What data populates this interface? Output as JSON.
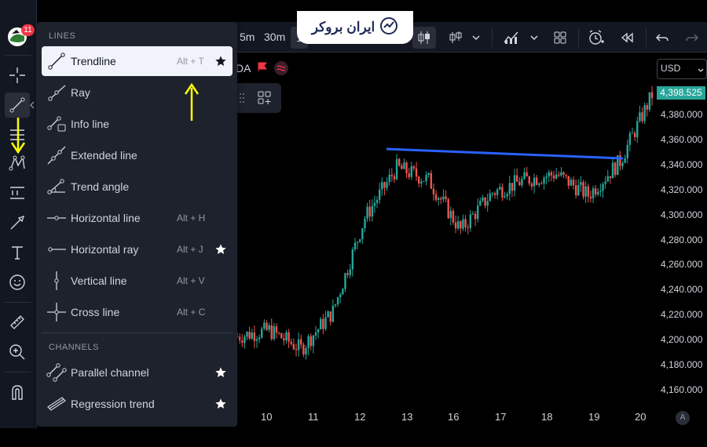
{
  "logo": {
    "text": "ایران بروکر"
  },
  "header": {
    "notification_count": "11",
    "timeframes": [
      "5m",
      "30m",
      "1"
    ],
    "symbol_fragment": "DA"
  },
  "currency": {
    "label": "USD"
  },
  "menu": {
    "lines_header": "LINES",
    "channels_header": "CHANNELS",
    "items": [
      {
        "label": "Trendline",
        "shortcut": "Alt + T",
        "starred": true,
        "icon": "trendline-icon"
      },
      {
        "label": "Ray",
        "shortcut": "",
        "starred": false,
        "icon": "ray-icon"
      },
      {
        "label": "Info line",
        "shortcut": "",
        "starred": false,
        "icon": "info-line-icon"
      },
      {
        "label": "Extended line",
        "shortcut": "",
        "starred": false,
        "icon": "extended-line-icon"
      },
      {
        "label": "Trend angle",
        "shortcut": "",
        "starred": false,
        "icon": "trend-angle-icon"
      },
      {
        "label": "Horizontal line",
        "shortcut": "Alt + H",
        "starred": false,
        "icon": "horizontal-line-icon"
      },
      {
        "label": "Horizontal ray",
        "shortcut": "Alt + J",
        "starred": true,
        "icon": "horizontal-ray-icon"
      },
      {
        "label": "Vertical line",
        "shortcut": "Alt + V",
        "starred": false,
        "icon": "vertical-line-icon"
      },
      {
        "label": "Cross line",
        "shortcut": "Alt + C",
        "starred": false,
        "icon": "cross-line-icon"
      }
    ],
    "channel_items": [
      {
        "label": "Parallel channel",
        "starred": true,
        "icon": "parallel-channel-icon"
      },
      {
        "label": "Regression trend",
        "starred": true,
        "icon": "regression-trend-icon"
      }
    ]
  },
  "price_axis": {
    "current_price": "4,398.525",
    "labels": [
      "4,380.000",
      "4,360.000",
      "4,340.000",
      "4,320.000",
      "4,300.000",
      "4,280.000",
      "4,260.000",
      "4,240.000",
      "4,220.000",
      "4,200.000",
      "4,180.000",
      "4,160.000"
    ]
  },
  "date_axis": {
    "labels": [
      "10",
      "11",
      "12",
      "13",
      "16",
      "17",
      "18",
      "19",
      "20"
    ],
    "auto_label": "A"
  },
  "colors": {
    "up": "#26a69a",
    "down": "#ef5350",
    "trendline": "#2962ff",
    "arrow": "#ffff00",
    "background": "#000000",
    "panel": "#1e222d"
  },
  "chart_data": {
    "type": "candlestick",
    "x": [
      "10",
      "11",
      "12",
      "13",
      "16",
      "17",
      "18",
      "19",
      "20"
    ],
    "trendline": {
      "start": 4351,
      "end": 4344
    },
    "approx_path": [
      4205,
      4210,
      4195,
      4225,
      4300,
      4340,
      4330,
      4290,
      4320,
      4330,
      4335,
      4318,
      4345,
      4398
    ],
    "ylim": [
      4150,
      4410
    ]
  }
}
